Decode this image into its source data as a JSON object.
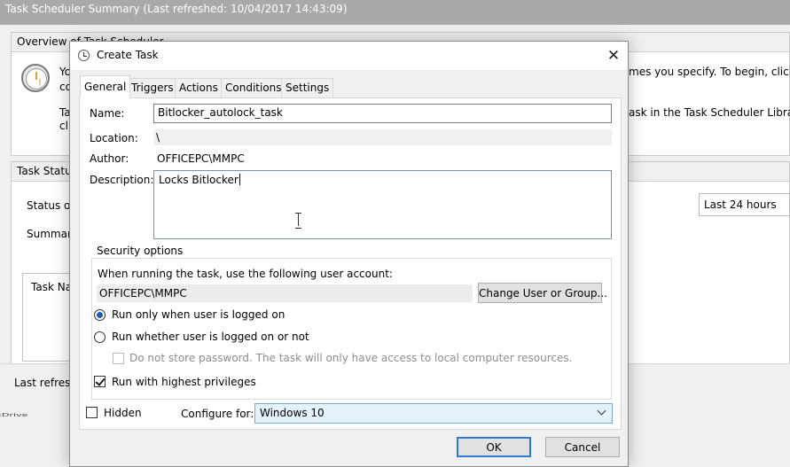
{
  "background": {
    "title": "Task Scheduler Summary (Last refreshed: 10/04/2017 14:43:09)",
    "overview_heading": "Overview of Task Scheduler",
    "overview_line1_left": "Yo",
    "overview_line1_right": "mes you specify. To begin, click a",
    "overview_line2_left": "co",
    "overview_line3_left": "Ta",
    "overview_line3_right": "ask in the Task Scheduler Library an",
    "overview_line4_left": "cl",
    "status_heading": "Task Status",
    "status_of_label": "Status of",
    "summary_label": "Summary",
    "time_filter": "Last 24 hours",
    "task_name_col": "Task Na",
    "last_refresh_label": "Last refresh",
    "truncated_bottom": "cDrive"
  },
  "dialog": {
    "title": "Create Task",
    "tabs": [
      {
        "label": "General",
        "active": true
      },
      {
        "label": "Triggers",
        "active": false
      },
      {
        "label": "Actions",
        "active": false
      },
      {
        "label": "Conditions",
        "active": false
      },
      {
        "label": "Settings",
        "active": false
      }
    ],
    "name_label": "Name:",
    "name_value": "Bitlocker_autolock_task",
    "location_label": "Location:",
    "location_value": "\\",
    "author_label": "Author:",
    "author_value": "OFFICEPC\\MMPC",
    "description_label": "Description:",
    "description_value": "Locks Bitlocker",
    "security": {
      "legend": "Security options",
      "account_prompt": "When running the task, use the following user account:",
      "account_value": "OFFICEPC\\MMPC",
      "change_button": "Change User or Group...",
      "radio_logged_on": "Run only when user is logged on",
      "radio_whether": "Run whether user is logged on or not",
      "no_store_password": "Do not store password.  The task will only have access to local computer resources.",
      "highest_privileges": "Run with highest privileges"
    },
    "hidden_label": "Hidden",
    "configure_label": "Configure for:",
    "configure_value": "Windows 10",
    "ok_label": "OK",
    "cancel_label": "Cancel"
  },
  "colors": {
    "accent": "#1a5fb4",
    "focus_border": "#2f7ad1",
    "select_bg": "#e5f1fb"
  }
}
